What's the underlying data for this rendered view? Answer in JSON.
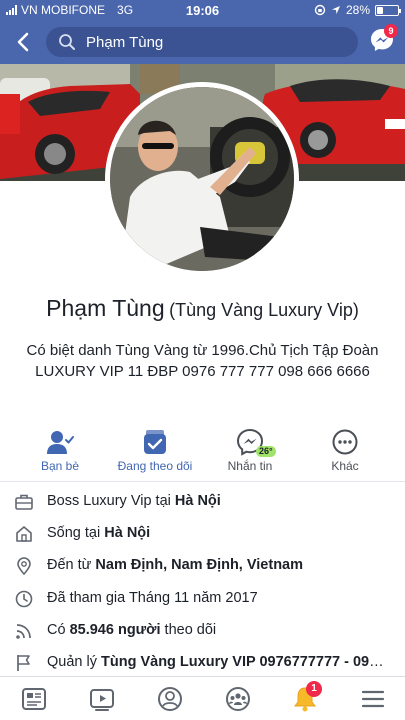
{
  "status_bar": {
    "carrier": "VN MOBIFONE",
    "network": "3G",
    "time": "19:06",
    "battery_text": "28%",
    "battery_level": 0.28
  },
  "search": {
    "query": "Phạm Tùng"
  },
  "messenger_badge": "9",
  "profile": {
    "name": "Phạm Tùng",
    "alt_name": "(Tùng Vàng Luxury Vip)",
    "bio": "Có biệt danh Tùng Vàng từ 1996.Chủ Tịch      Tập Đoàn LUXURY VIP 11 ĐBP 0976 777 777      098 666 6666"
  },
  "actions": [
    {
      "label": "Bạn bè",
      "icon": "friends-icon"
    },
    {
      "label": "Đang theo dõi",
      "icon": "following-icon"
    },
    {
      "label": "Nhắn tin",
      "icon": "messenger-icon"
    },
    {
      "label": "Khác",
      "icon": "more-icon"
    }
  ],
  "weather_badge": "26°",
  "info": {
    "work": {
      "prefix": "Boss Luxury Vip tại ",
      "value": "Hà Nội"
    },
    "lives": {
      "prefix": "Sống tại ",
      "value": "Hà Nội"
    },
    "from": {
      "prefix": "Đến từ ",
      "value": "Nam Định, Nam Định, Vietnam"
    },
    "joined": {
      "text": "Đã tham gia Tháng 11 năm 2017"
    },
    "followers": {
      "prefix": "Có ",
      "value": "85.946 người",
      "suffix": " theo dõi"
    },
    "manages": {
      "prefix": "Quản lý ",
      "value": "Tùng Vàng Luxury VIP 0976777777 - 098..."
    }
  },
  "notifications_badge": "1",
  "colors": {
    "brand_blue": "#4a67ad",
    "link_blue": "#4267b2",
    "badge_red": "#f02849"
  }
}
